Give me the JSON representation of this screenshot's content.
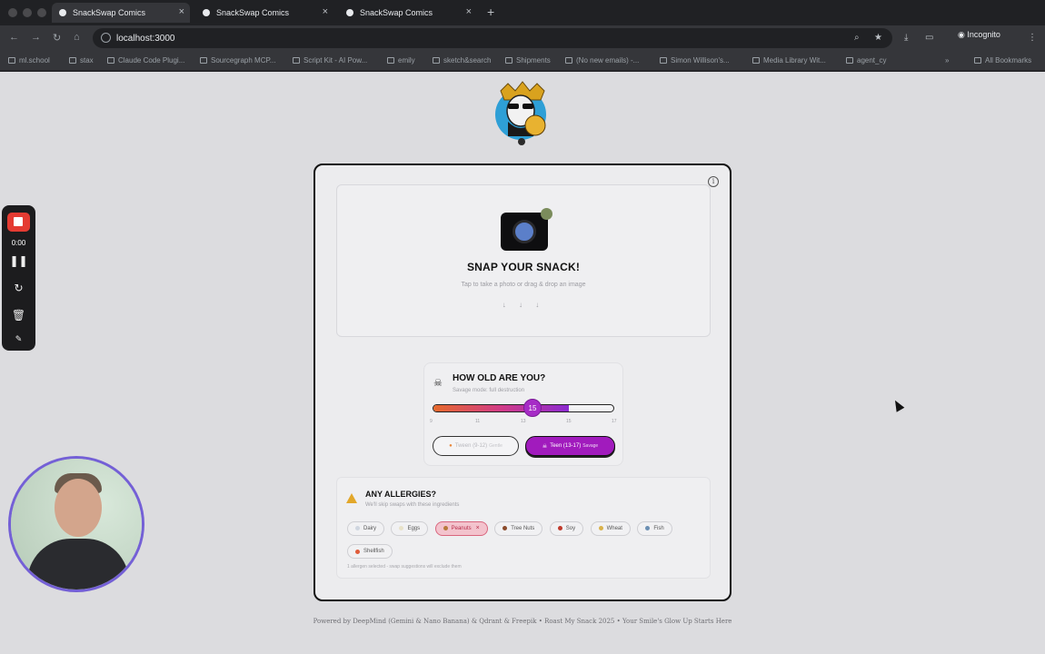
{
  "browser": {
    "tabs": [
      {
        "title": "SnackSwap Comics",
        "active": true
      },
      {
        "title": "SnackSwap Comics",
        "active": false
      },
      {
        "title": "SnackSwap Comics",
        "active": false
      }
    ],
    "url": "localhost:3000",
    "profile_label": "Incognito",
    "bookmarks": [
      "ml.school",
      "stax",
      "Claude Code Plugi...",
      "Sourcegraph MCP...",
      "Script Kit - AI Pow...",
      "emily",
      "sketch&search",
      "Shipments",
      "(No new emails) -...",
      "Simon Willison's...",
      "Media Library Wit...",
      "agent_cy"
    ],
    "all_bookmarks_label": "All Bookmarks"
  },
  "snap": {
    "title": "SNAP YOUR SNACK!",
    "subtitle": "Tap to take a photo or drag & drop an image",
    "arrows": "↓ ↓ ↓"
  },
  "age": {
    "title": "HOW OLD ARE YOU?",
    "hint": "Savage mode: full destruction",
    "value": 15,
    "min": 9,
    "max": 17,
    "ticks": [
      "9",
      "11",
      "13",
      "15",
      "17"
    ],
    "tween_label": "Tween (9-12)",
    "tween_mode": "Gentle",
    "teen_label": "Teen (13-17)",
    "teen_mode": "Savage"
  },
  "allergies": {
    "title": "ANY ALLERGIES?",
    "hint": "We'll skip swaps with these ingredients",
    "items": [
      {
        "label": "Dairy",
        "selected": false,
        "icon": "milk-icon",
        "color": "#cfd6e0"
      },
      {
        "label": "Eggs",
        "selected": false,
        "icon": "egg-icon",
        "color": "#e8e2c8"
      },
      {
        "label": "Peanuts",
        "selected": true,
        "icon": "peanut-icon",
        "color": "#b77a3a"
      },
      {
        "label": "Tree Nuts",
        "selected": false,
        "icon": "tree-nut-icon",
        "color": "#8a4a2a"
      },
      {
        "label": "Soy",
        "selected": false,
        "icon": "soy-icon",
        "color": "#c0392b"
      },
      {
        "label": "Wheat",
        "selected": false,
        "icon": "wheat-icon",
        "color": "#d9b24a"
      },
      {
        "label": "Fish",
        "selected": false,
        "icon": "fish-icon",
        "color": "#6b8fb3"
      },
      {
        "label": "Shellfish",
        "selected": false,
        "icon": "shellfish-icon",
        "color": "#e05c3a"
      }
    ],
    "footer": "1 allergen selected - swap suggestions will exclude them"
  },
  "footer": "Powered by DeepMind (Gemini & Nano Banana) & Qdrant & Freepik • Roast My Snack 2025 • Your Smile's Glow Up Starts Here",
  "recorder": {
    "time": "0:00"
  }
}
